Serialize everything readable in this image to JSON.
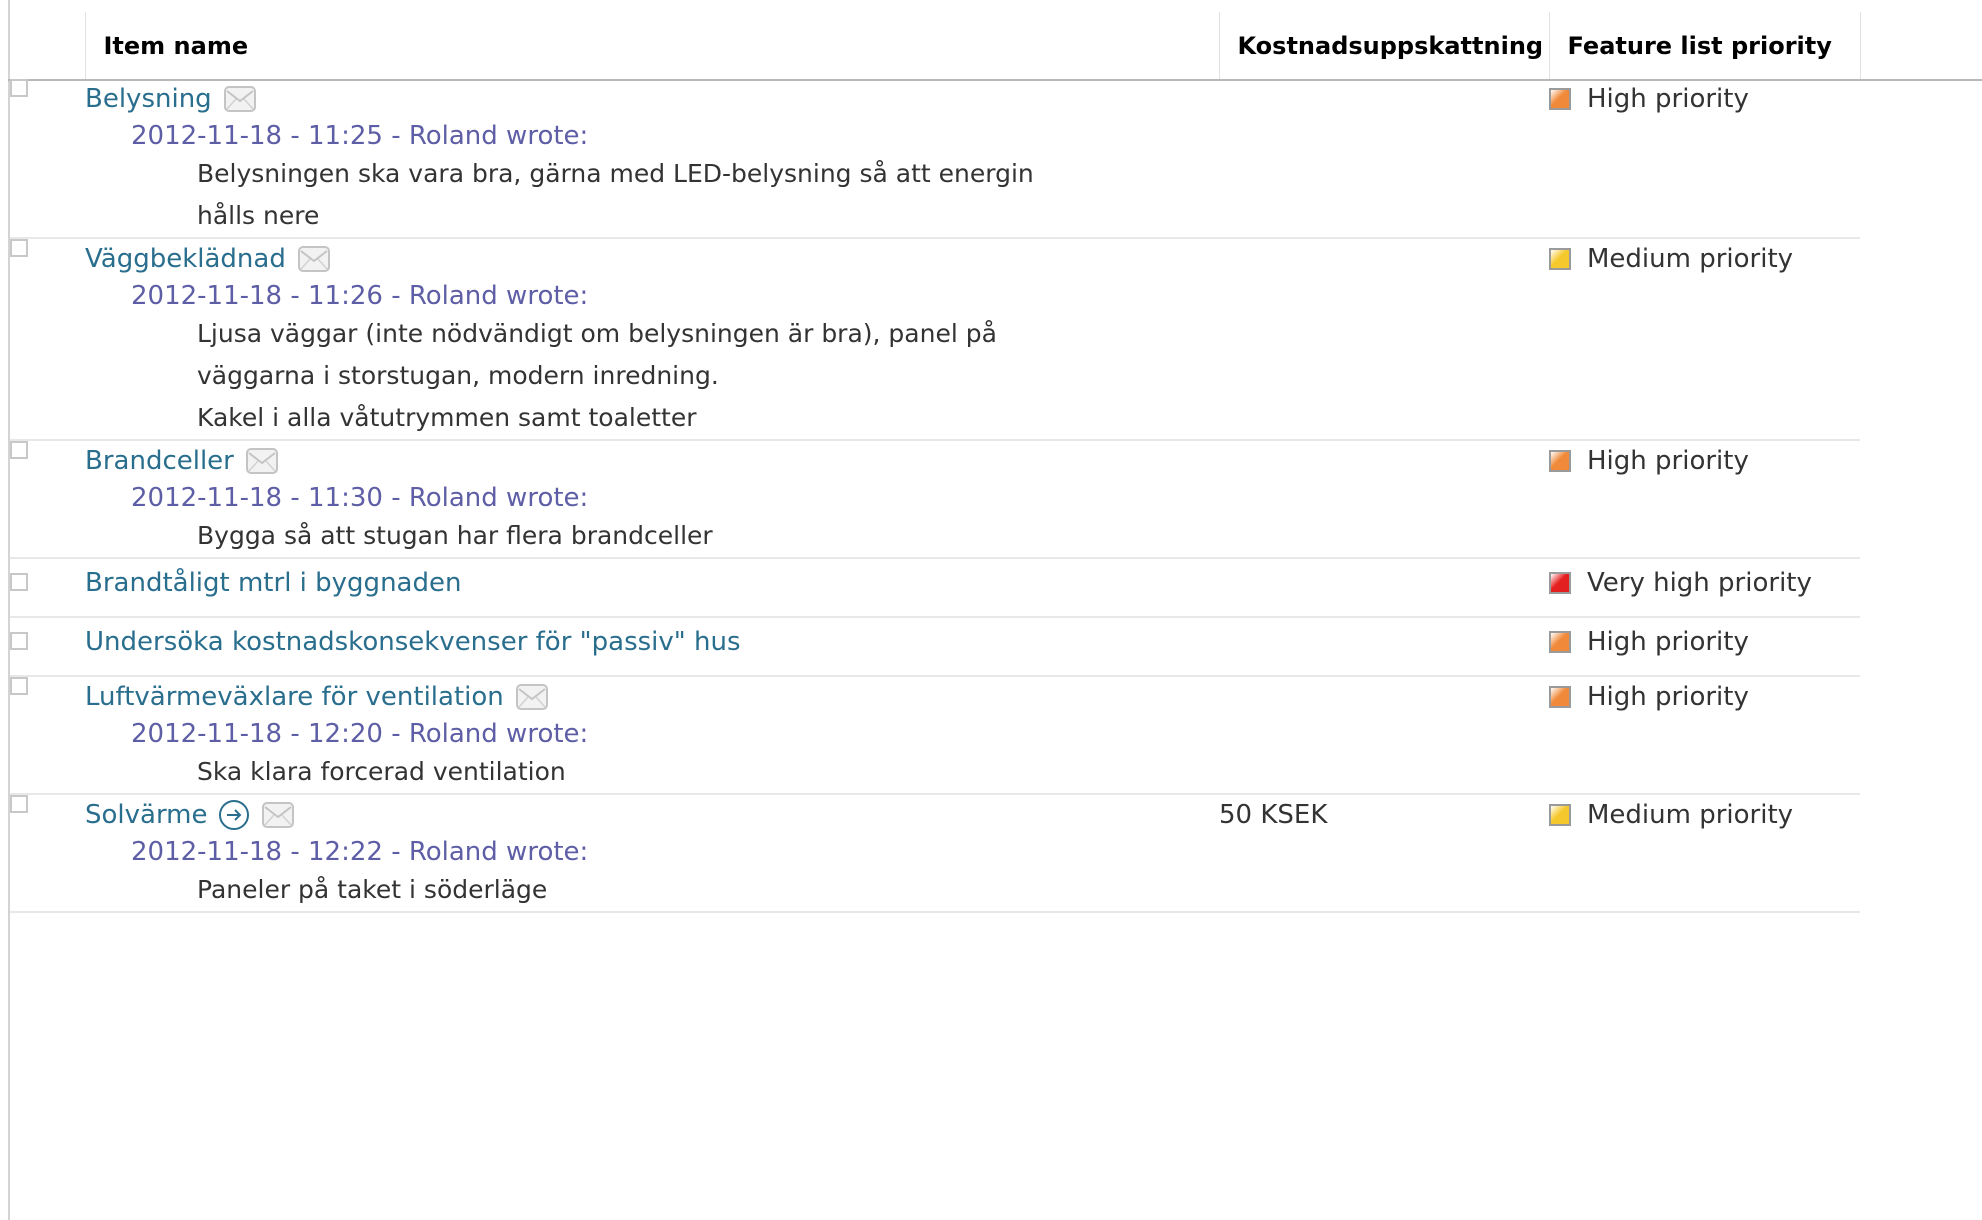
{
  "columns": {
    "title": "Item name",
    "cost": "Kostnadsuppskattning",
    "priority": "Feature list priority"
  },
  "colors": {
    "link": "#2a6e8e",
    "comment_header": "#5e5ea6",
    "high_priority": "#f08a3a",
    "medium_priority": "#f5c92e",
    "very_high_priority": "#e41f1f"
  },
  "items": [
    {
      "title": "Belysning",
      "icons": [
        "envelope-icon"
      ],
      "comment_header": "2012-11-18 - 11:25 - Roland wrote:",
      "comment_lines": [
        "Belysningen ska vara bra, gärna med LED-belysning så att energin hålls nere"
      ],
      "cost": "",
      "priority": "High priority",
      "priority_color": "#f08a3a"
    },
    {
      "title": "Väggbeklädnad",
      "icons": [
        "envelope-icon"
      ],
      "comment_header": "2012-11-18 - 11:26 - Roland wrote:",
      "comment_lines": [
        "Ljusa väggar (inte nödvändigt om belysningen är bra), panel på väggarna i storstugan, modern inredning.",
        "Kakel i alla våtutrymmen samt toaletter"
      ],
      "cost": "",
      "priority": "Medium priority",
      "priority_color": "#f5c92e"
    },
    {
      "title": "Brandceller",
      "icons": [
        "envelope-icon"
      ],
      "comment_header": "2012-11-18 - 11:30 - Roland wrote:",
      "comment_lines": [
        "Bygga så att stugan har flera brandceller"
      ],
      "cost": "",
      "priority": "High priority",
      "priority_color": "#f08a3a"
    },
    {
      "title": "Brandtåligt mtrl i byggnaden",
      "icons": [],
      "comment_header": "",
      "comment_lines": [],
      "cost": "",
      "priority": "Very high priority",
      "priority_color": "#e41f1f"
    },
    {
      "title": "Undersöka kostnadskonsekvenser för \"passiv\" hus",
      "icons": [],
      "comment_header": "",
      "comment_lines": [],
      "cost": "",
      "priority": "High priority",
      "priority_color": "#f08a3a"
    },
    {
      "title": "Luftvärmeväxlare för ventilation",
      "icons": [
        "envelope-icon"
      ],
      "comment_header": "2012-11-18 - 12:20 - Roland wrote:",
      "comment_lines": [
        "Ska klara forcerad ventilation"
      ],
      "cost": "",
      "priority": "High priority",
      "priority_color": "#f08a3a"
    },
    {
      "title": "Solvärme",
      "icons": [
        "navigate-arrow-icon",
        "envelope-icon"
      ],
      "comment_header": "2012-11-18 - 12:22 - Roland wrote:",
      "comment_lines": [
        "Paneler på taket i söderläge"
      ],
      "cost": "50 KSEK",
      "priority": "Medium priority",
      "priority_color": "#f5c92e"
    }
  ]
}
